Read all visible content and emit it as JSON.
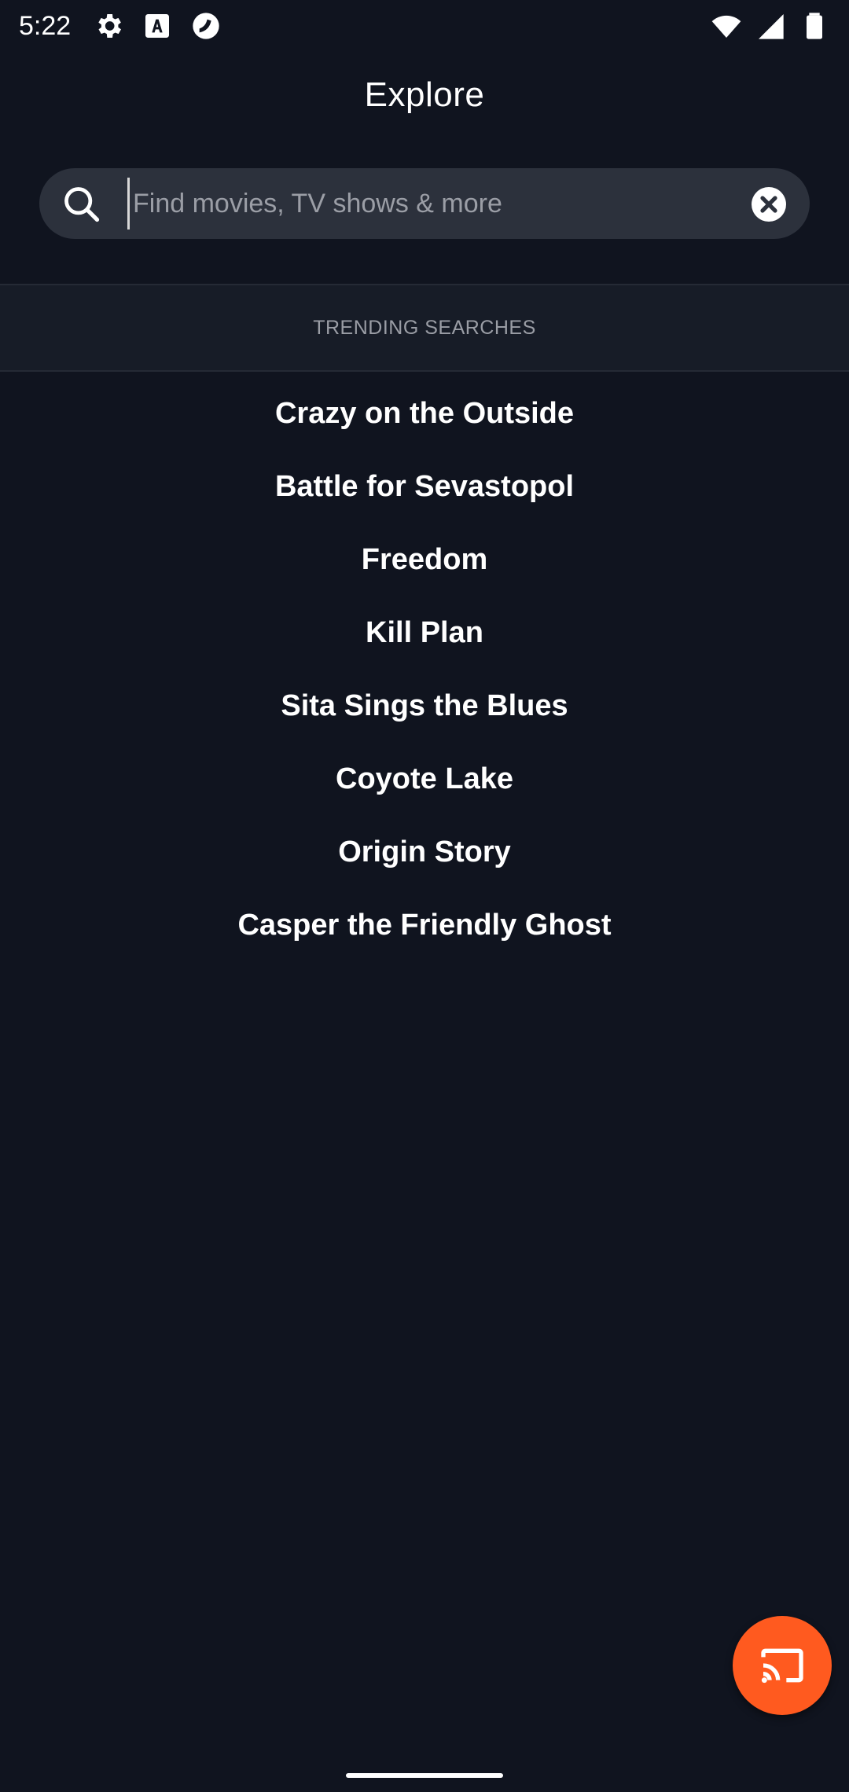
{
  "status_bar": {
    "time": "5:22",
    "left_icons": [
      "settings-icon",
      "font-icon",
      "app-icon"
    ],
    "right_icons": [
      "wifi-icon",
      "signal-icon",
      "battery-icon"
    ]
  },
  "header": {
    "title": "Explore"
  },
  "search": {
    "placeholder": "Find movies, TV shows & more",
    "value": ""
  },
  "trending": {
    "heading": "TRENDING SEARCHES",
    "items": [
      "Crazy on the Outside",
      "Battle for Sevastopol",
      "Freedom",
      "Kill Plan",
      "Sita Sings the Blues",
      "Coyote Lake",
      "Origin Story",
      "Casper the Friendly Ghost"
    ]
  },
  "cast": {
    "icon": "cast-icon",
    "color": "#ff5a1f"
  },
  "colors": {
    "background": "#10141f",
    "search_bg": "#2c313c",
    "accent": "#ff5a1f"
  }
}
